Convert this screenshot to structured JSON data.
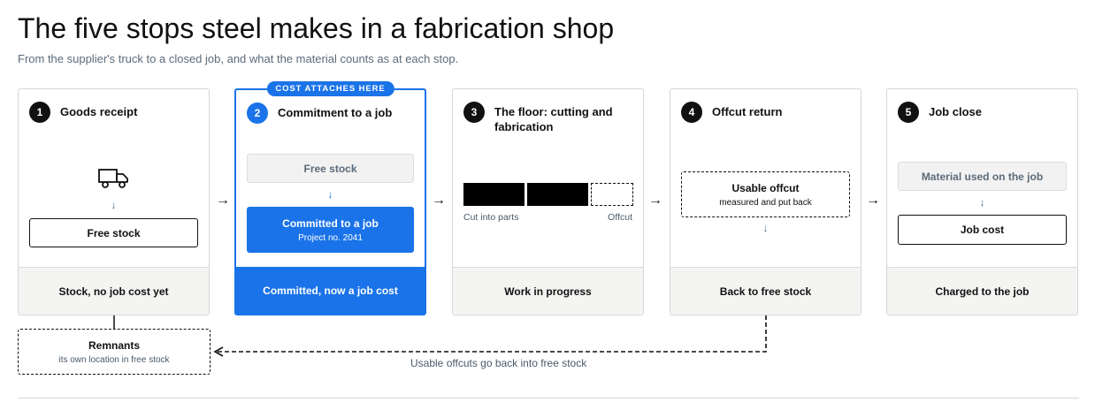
{
  "page": {
    "title": "The five stops steel makes in a fabrication shop",
    "subtitle": "From the supplier's truck to a closed job, and what the material counts as at each stop."
  },
  "stops": [
    {
      "number": "1",
      "label": "Goods receipt",
      "icon": "truck-icon",
      "box": "Free stock",
      "footer": "Stock, no job cost yet"
    },
    {
      "number": "2",
      "label": "Commitment to a job",
      "badge": "COST ATTACHES HERE",
      "from_box": "Free stock",
      "to_box": "Committed to a job",
      "to_box_sub": "Project no. 2041",
      "footer": "Committed, now a job cost"
    },
    {
      "number": "3",
      "label": "The floor: cutting and fabrication",
      "parts_label": "Cut into parts",
      "offcut_label": "Offcut",
      "footer": "Work in progress"
    },
    {
      "number": "4",
      "label": "Offcut return",
      "box": "Usable offcut",
      "box_sub": "measured and put back",
      "footer": "Back to free stock"
    },
    {
      "number": "5",
      "label": "Job close",
      "from_box": "Material used on the job",
      "to_box": "Job cost",
      "footer": "Charged to the job"
    }
  ],
  "remnants": {
    "title": "Remnants",
    "subtitle": "its own location in free stock"
  },
  "loop": {
    "label": "Usable offcuts go back into free stock"
  },
  "colors": {
    "accent": "#1a73e8",
    "ink": "#111111",
    "muted": "#5b6b7a",
    "footer_bg": "#f4f4f2"
  }
}
